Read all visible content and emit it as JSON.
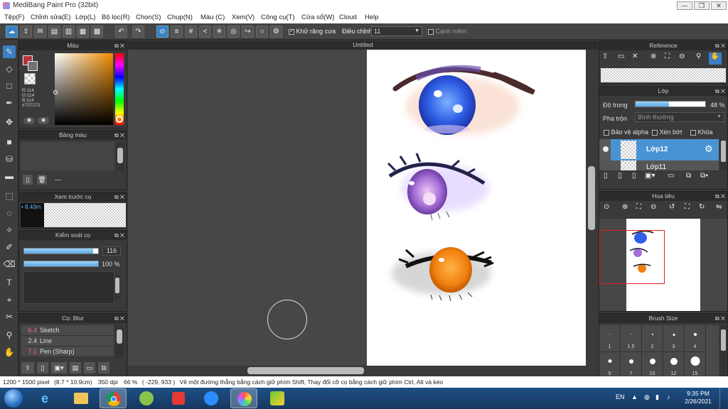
{
  "app": {
    "title": "MediBang Paint Pro (32bit)"
  },
  "menu": [
    "Tệp(F)",
    "Chỉnh sửa(E)",
    "Lớp(L)",
    "Bộ lọc(R)",
    "Chọn(S)",
    "Chụp(N)",
    "Màu (C)",
    "Xem(V)",
    "Công cụ(T)",
    "Cửa sổ(W)",
    "Cloud",
    "Help"
  ],
  "toolbar": {
    "antialias_label": "Khử răng cưa",
    "adjust_label": "Điều chỉnh",
    "adjust_value": "11",
    "edge_label": "Cạnh mềm"
  },
  "color_panel": {
    "title": "Màu",
    "r": "R:114",
    "g": "G:114",
    "b": "B:114",
    "hex": "#727272"
  },
  "palette_panel": {
    "title": "Bảng màu",
    "dash": "---"
  },
  "brush_preview": {
    "title": "Xem trước cọ",
    "size": "8.43m"
  },
  "brush_control": {
    "title": "Kiểm soát cọ",
    "size": "116",
    "opacity": "100 %",
    "size_fraction": 0.93,
    "opacity_fraction": 1.0
  },
  "brush_list": {
    "title": "Cọ: Blur",
    "items": [
      {
        "num": "6.4",
        "name": "Sketch"
      },
      {
        "num": "2.4",
        "name": "Line"
      },
      {
        "num": "7.1",
        "name": "Pen (Sharp)"
      }
    ]
  },
  "canvas": {
    "title": "Untitled"
  },
  "reference_panel": {
    "title": "Reference"
  },
  "layer_panel": {
    "title": "Lớp",
    "opacity_label": "Độ trong",
    "opacity_value": "48 %",
    "opacity_fraction": 0.48,
    "blend_label": "Pha trộn",
    "blend_value": "Bình thường",
    "protect_alpha": "Bảo vệ alpha",
    "clipping": "Xén bớt",
    "lock": "Khóa",
    "layers": [
      {
        "name": "Lớp12"
      },
      {
        "name": "Lớp11"
      }
    ]
  },
  "navigator_panel": {
    "title": "Hoa tiêu"
  },
  "brush_size_panel": {
    "title": "Brush Size",
    "sizes": [
      "1",
      "1.5",
      "2",
      "3",
      "4",
      "5",
      "7",
      "10",
      "12",
      "15"
    ]
  },
  "status": {
    "dimensions": "1200 * 1500 pixel",
    "physical": "(8.7 * 10.9cm)",
    "dpi": "350 dpi",
    "zoom": "66 %",
    "coords": "( -229, 933 )",
    "hint": "Vẽ một đường thẳng bằng cách giữ phím Shift, Thay đổi cỡ cọ bằng cách giữ phím Ctrl, Alt và kéo"
  },
  "taskbar": {
    "lang": "EN",
    "time": "9:35 PM",
    "date": "2/26/2021"
  }
}
